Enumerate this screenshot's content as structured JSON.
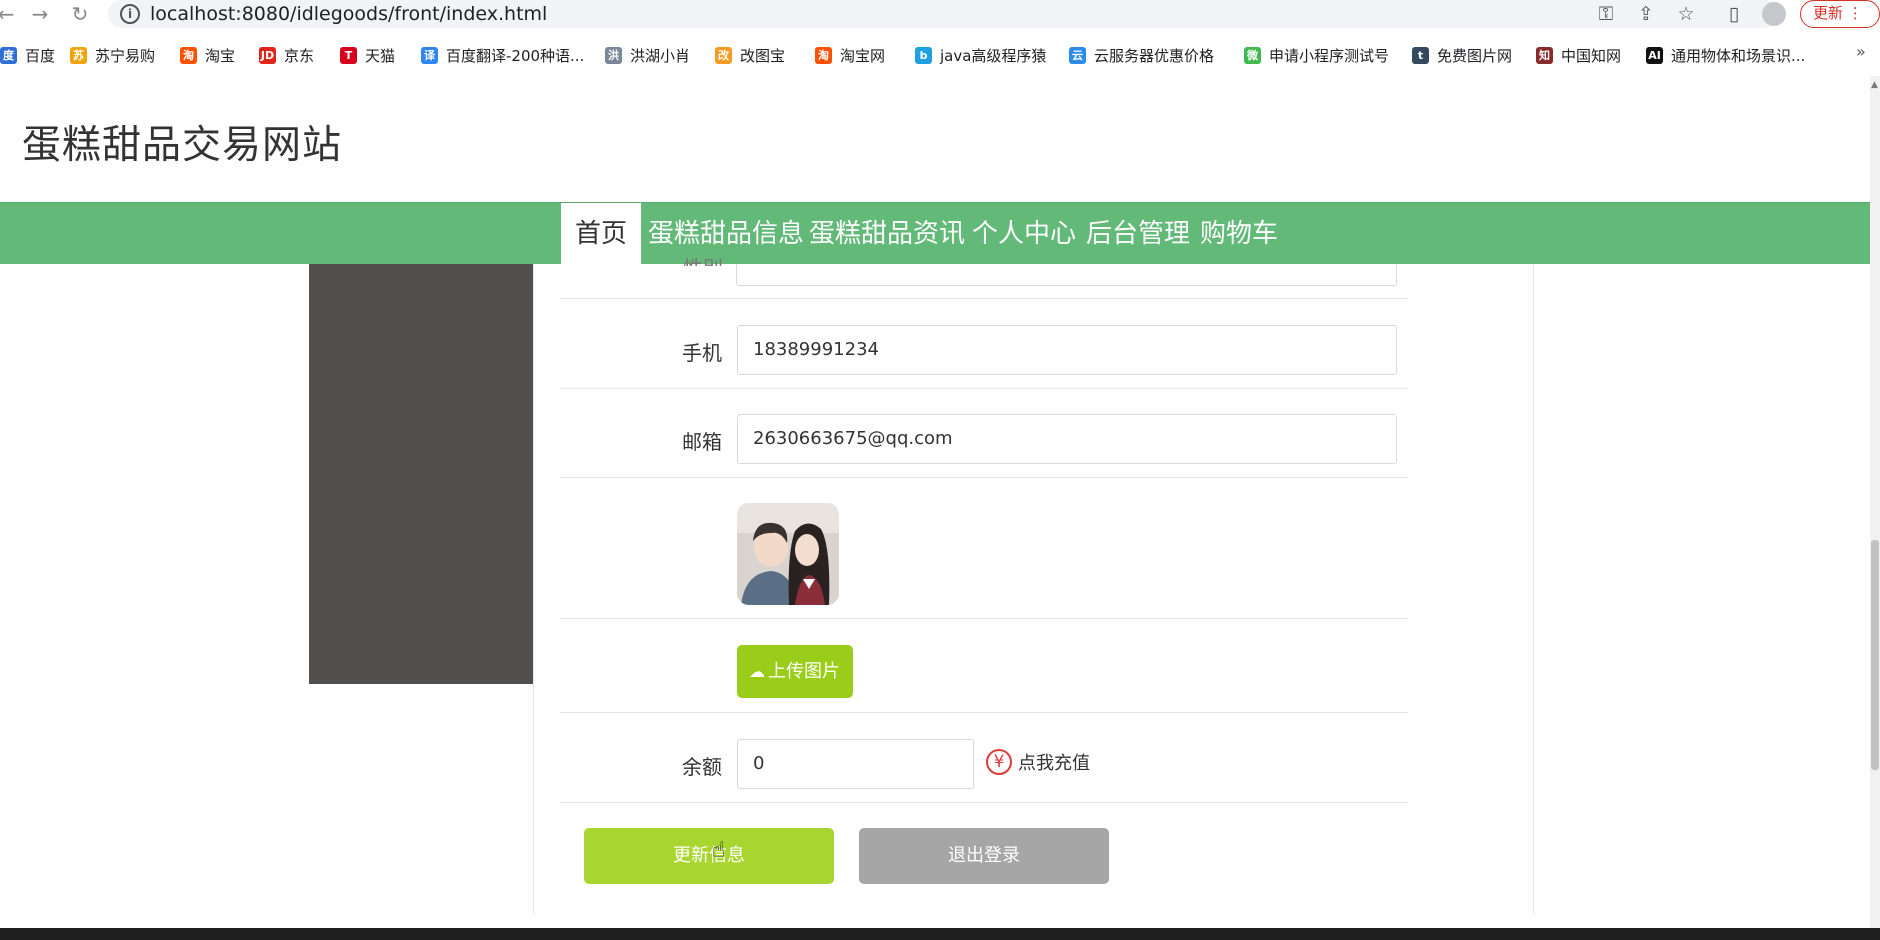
{
  "browser": {
    "url": "localhost:8080/idlegoods/front/index.html",
    "update_label": "更新",
    "bookmarks": [
      {
        "label": "百度",
        "color": "#2e6fd8",
        "glyph": "度"
      },
      {
        "label": "苏宁易购",
        "color": "#f0a30a",
        "glyph": "苏"
      },
      {
        "label": "淘宝",
        "color": "#ff5000",
        "glyph": "淘"
      },
      {
        "label": "京东",
        "color": "#e1251b",
        "glyph": "JD"
      },
      {
        "label": "天猫",
        "color": "#d6001c",
        "glyph": "T"
      },
      {
        "label": "百度翻译-200种语...",
        "color": "#2e86f5",
        "glyph": "译"
      },
      {
        "label": "洪湖小肖",
        "color": "#7a8799",
        "glyph": "洪"
      },
      {
        "label": "改图宝",
        "color": "#f59b23",
        "glyph": "改"
      },
      {
        "label": "淘宝网",
        "color": "#ff5000",
        "glyph": "淘"
      },
      {
        "label": "java高级程序猿",
        "color": "#20a0e0",
        "glyph": "b"
      },
      {
        "label": "云服务器优惠价格",
        "color": "#2b8be8",
        "glyph": "云"
      },
      {
        "label": "申请小程序测试号",
        "color": "#3fb950",
        "glyph": "微"
      },
      {
        "label": "免费图片网",
        "color": "#354a5f",
        "glyph": "t"
      },
      {
        "label": "中国知网",
        "color": "#8a2b2b",
        "glyph": "知"
      },
      {
        "label": "通用物体和场景识...",
        "color": "#111111",
        "glyph": "AI"
      }
    ]
  },
  "site": {
    "title": "蛋糕甜品交易网站",
    "nav": [
      "首页",
      "蛋糕甜品信息",
      "蛋糕甜品资讯",
      "个人中心",
      "后台管理",
      "购物车"
    ]
  },
  "form": {
    "gender_label": "性别",
    "phone_label": "手机",
    "phone_value": "18389991234",
    "email_label": "邮箱",
    "email_value": "2630663675@qq.com",
    "upload_label": "上传图片",
    "balance_label": "余额",
    "balance_value": "0",
    "recharge_label": "点我充值",
    "update_button": "更新信息",
    "logout_button": "退出登录"
  },
  "colors": {
    "nav_green": "#62b978",
    "upload_green": "#9acd1a",
    "update_green": "#a8d530",
    "logout_gray": "#a6a6a6",
    "sidebar_dark": "#534f4e"
  }
}
